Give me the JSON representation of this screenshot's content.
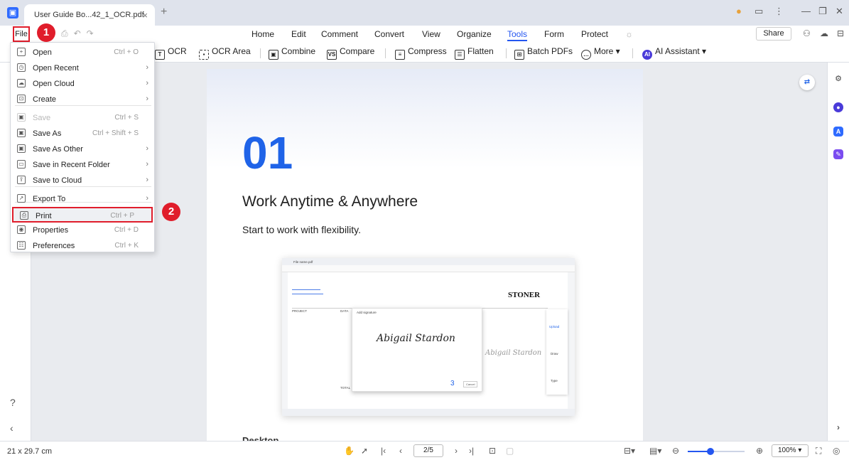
{
  "titlebar": {
    "tab_title": "User Guide Bo...42_1_OCR.pdf",
    "tab_close": "×",
    "new_tab": "+"
  },
  "menubar": {
    "file": "File",
    "tabs": [
      "Home",
      "Edit",
      "Comment",
      "Convert",
      "View",
      "Organize",
      "Tools",
      "Form",
      "Protect"
    ],
    "active_tab": "Tools",
    "share": "Share"
  },
  "toolbar": {
    "ocr": "OCR",
    "ocr_area": "OCR Area",
    "combine": "Combine",
    "compare": "Compare",
    "compress": "Compress",
    "flatten": "Flatten",
    "batch": "Batch PDFs",
    "more": "More",
    "ai": "AI Assistant"
  },
  "file_menu": {
    "items": [
      {
        "label": "Open",
        "shortcut": "Ctrl + O",
        "arrow": ""
      },
      {
        "label": "Open Recent",
        "shortcut": "",
        "arrow": "›"
      },
      {
        "label": "Open Cloud",
        "shortcut": "",
        "arrow": "›"
      },
      {
        "label": "Create",
        "shortcut": "",
        "arrow": "›"
      },
      {
        "label": "Save",
        "shortcut": "Ctrl + S",
        "arrow": ""
      },
      {
        "label": "Save As",
        "shortcut": "Ctrl + Shift + S",
        "arrow": ""
      },
      {
        "label": "Save As Other",
        "shortcut": "",
        "arrow": "›"
      },
      {
        "label": "Save in Recent Folder",
        "shortcut": "",
        "arrow": "›"
      },
      {
        "label": "Save to Cloud",
        "shortcut": "",
        "arrow": "›"
      },
      {
        "label": "Export To",
        "shortcut": "",
        "arrow": "›"
      },
      {
        "label": "Print",
        "shortcut": "Ctrl + P",
        "arrow": ""
      },
      {
        "label": "Properties",
        "shortcut": "Ctrl + D",
        "arrow": ""
      },
      {
        "label": "Preferences",
        "shortcut": "Ctrl + K",
        "arrow": ""
      }
    ]
  },
  "callouts": {
    "one": "1",
    "two": "2"
  },
  "page": {
    "number": "01",
    "title": "Work Anytime & Anywhere",
    "subtitle": "Start to work with flexibility.",
    "next_heading": "Desktop"
  },
  "embedded": {
    "stoner": "STONER",
    "signature": "Abigail Stardon",
    "step": "3",
    "cancel": "Cancel",
    "upload": "Upload",
    "draw": "Draw",
    "type": "Type",
    "file_name": "File name.pdf",
    "add_signature": "Add signature",
    "project": "PROJECT",
    "data": "DATA",
    "total": "TOTAL"
  },
  "statusbar": {
    "dimensions": "21 x 29.7 cm",
    "page_current": "2",
    "page_total": "5",
    "zoom": "100%",
    "zoom_fraction": 0.4
  },
  "colors": {
    "accent": "#2456f0",
    "callout": "#e01d2b",
    "number_blue": "#1f63e8"
  }
}
